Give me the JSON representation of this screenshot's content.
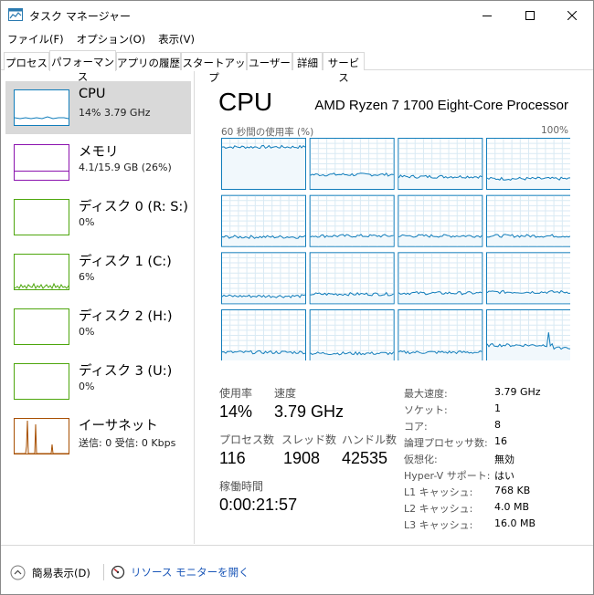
{
  "window": {
    "title": "タスク マネージャー"
  },
  "menu": [
    "ファイル(F)",
    "オプション(O)",
    "表示(V)"
  ],
  "tabs": [
    "プロセス",
    "パフォーマンス",
    "アプリの履歴",
    "スタートアップ",
    "ユーザー",
    "詳細",
    "サービス"
  ],
  "active_tab": "パフォーマンス",
  "sidebar": {
    "items": [
      {
        "name": "CPU",
        "sub": "14%  3.79 GHz",
        "color": "#117dbb"
      },
      {
        "name": "メモリ",
        "sub": "4.1/15.9 GB (26%)",
        "color": "#8b12ae"
      },
      {
        "name": "ディスク 0 (R: S:)",
        "sub": "0%",
        "color": "#4da60c"
      },
      {
        "name": "ディスク 1 (C:)",
        "sub": "6%",
        "color": "#4da60c"
      },
      {
        "name": "ディスク 2 (H:)",
        "sub": "0%",
        "color": "#4da60c"
      },
      {
        "name": "ディスク 3 (U:)",
        "sub": "0%",
        "color": "#4da60c"
      },
      {
        "name": "イーサネット",
        "sub": "送信: 0 受信: 0 Kbps",
        "color": "#a74f01"
      }
    ]
  },
  "main": {
    "title": "CPU",
    "model": "AMD Ryzen 7 1700 Eight-Core Processor",
    "graph_label": "60 秒間の使用率 (%)",
    "graph_max": "100%",
    "stats": {
      "usage_label": "使用率",
      "usage_value": "14%",
      "speed_label": "速度",
      "speed_value": "3.79 GHz",
      "processes_label": "プロセス数",
      "processes_value": "116",
      "threads_label": "スレッド数",
      "threads_value": "1908",
      "handles_label": "ハンドル数",
      "handles_value": "42535",
      "uptime_label": "稼働時間",
      "uptime_value": "0:00:21:57"
    },
    "info": [
      {
        "label": "最大速度:",
        "value": "3.79 GHz"
      },
      {
        "label": "ソケット:",
        "value": "1"
      },
      {
        "label": "コア:",
        "value": "8"
      },
      {
        "label": "論理プロセッサ数:",
        "value": "16"
      },
      {
        "label": "仮想化:",
        "value": "無効"
      },
      {
        "label": "Hyper-V サポート:",
        "value": "はい"
      },
      {
        "label": "L1 キャッシュ:",
        "value": "768 KB"
      },
      {
        "label": "L2 キャッシュ:",
        "value": "4.0 MB"
      },
      {
        "label": "L3 キャッシュ:",
        "value": "16.0 MB"
      }
    ]
  },
  "footer": {
    "fewer_details": "簡易表示(D)",
    "open_resmon": "リソース モニターを開く"
  },
  "colors": {
    "cpu_line": "#117dbb",
    "cpu_grid": "#d9eaf4",
    "memory": "#8b12ae",
    "disk": "#4da60c",
    "ethernet": "#a74f01",
    "selected": "#d9d9d9"
  }
}
